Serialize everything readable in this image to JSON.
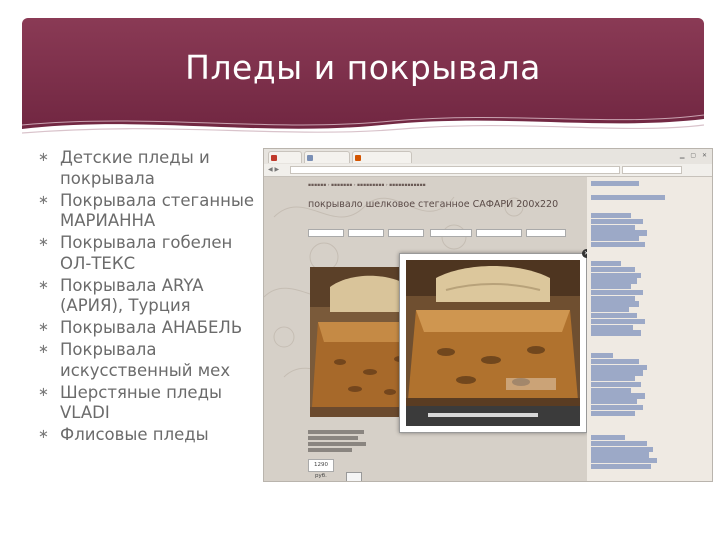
{
  "slide": {
    "title": "Пледы и покрывала",
    "bullet_symbol": "∗",
    "bullets": [
      "Детские пледы и покрывала",
      "Покрывала стеганные МАРИАННА",
      "Покрывала гобелен ОЛ-ТЕКС",
      "Покрывала ARYA (АРИЯ), Турция",
      "Покрывала АНАБЕЛЬ",
      "Покрывала искусственный мех",
      "Шерстяные пледы VLADI",
      "Флисовые пледы"
    ]
  },
  "colors": {
    "header": "#7e2f49",
    "bullet_text": "#6b6b6b",
    "screenshot_bg": "#d6d0c8",
    "sidebar_link": "#3b5998"
  },
  "screenshot": {
    "product_title": "покрывало шелковое стеганное САФАРИ 200х220",
    "price": "1290 руб.",
    "modal_close": "✕"
  }
}
